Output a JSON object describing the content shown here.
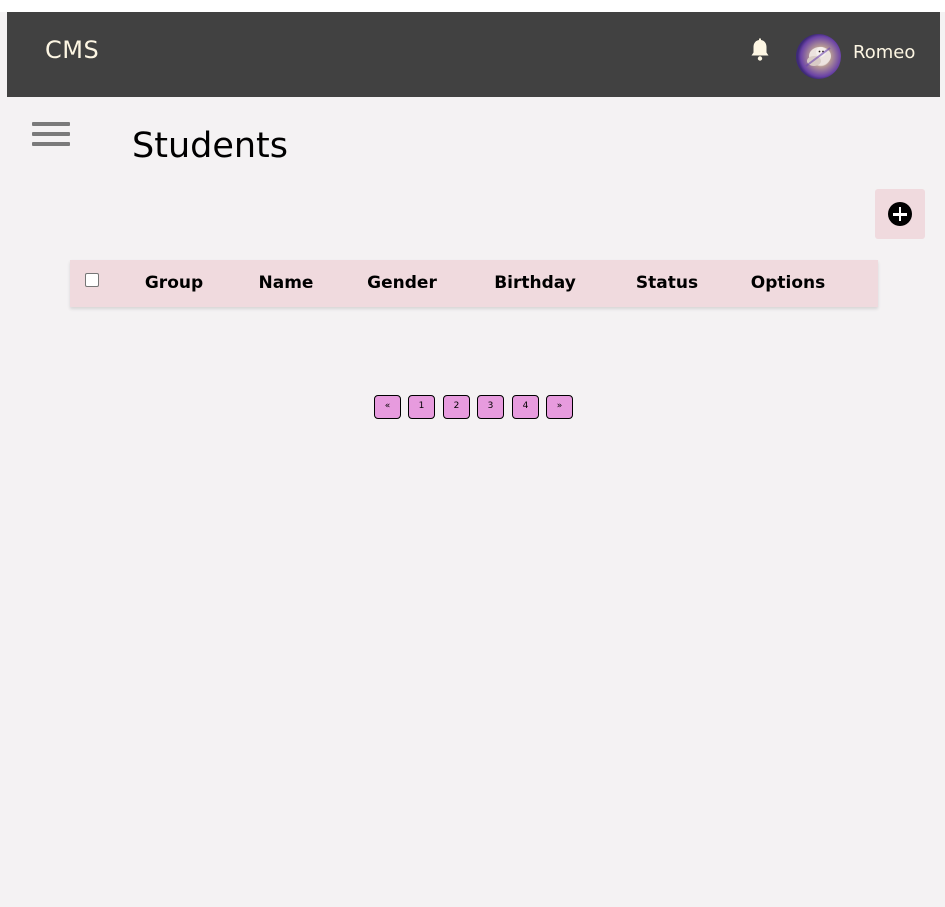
{
  "header": {
    "brand": "CMS",
    "user": {
      "name": "Romeo"
    },
    "icons": {
      "notifications": "bell-icon",
      "avatar": "user-avatar"
    }
  },
  "main": {
    "title": "Students",
    "add_button_icon": "plus-circle-icon"
  },
  "table": {
    "columns": [
      "Group",
      "Name",
      "Gender",
      "Birthday",
      "Status",
      "Options"
    ],
    "rows": []
  },
  "pagination": {
    "prev": "«",
    "pages": [
      "1",
      "2",
      "3",
      "4"
    ],
    "next": "»"
  },
  "colors": {
    "header_bg": "#414141",
    "header_text": "#fdf6e3",
    "page_bg": "#f4f2f3",
    "table_header_bg": "#f0dade",
    "pagination_button_bg": "#e79bde"
  }
}
